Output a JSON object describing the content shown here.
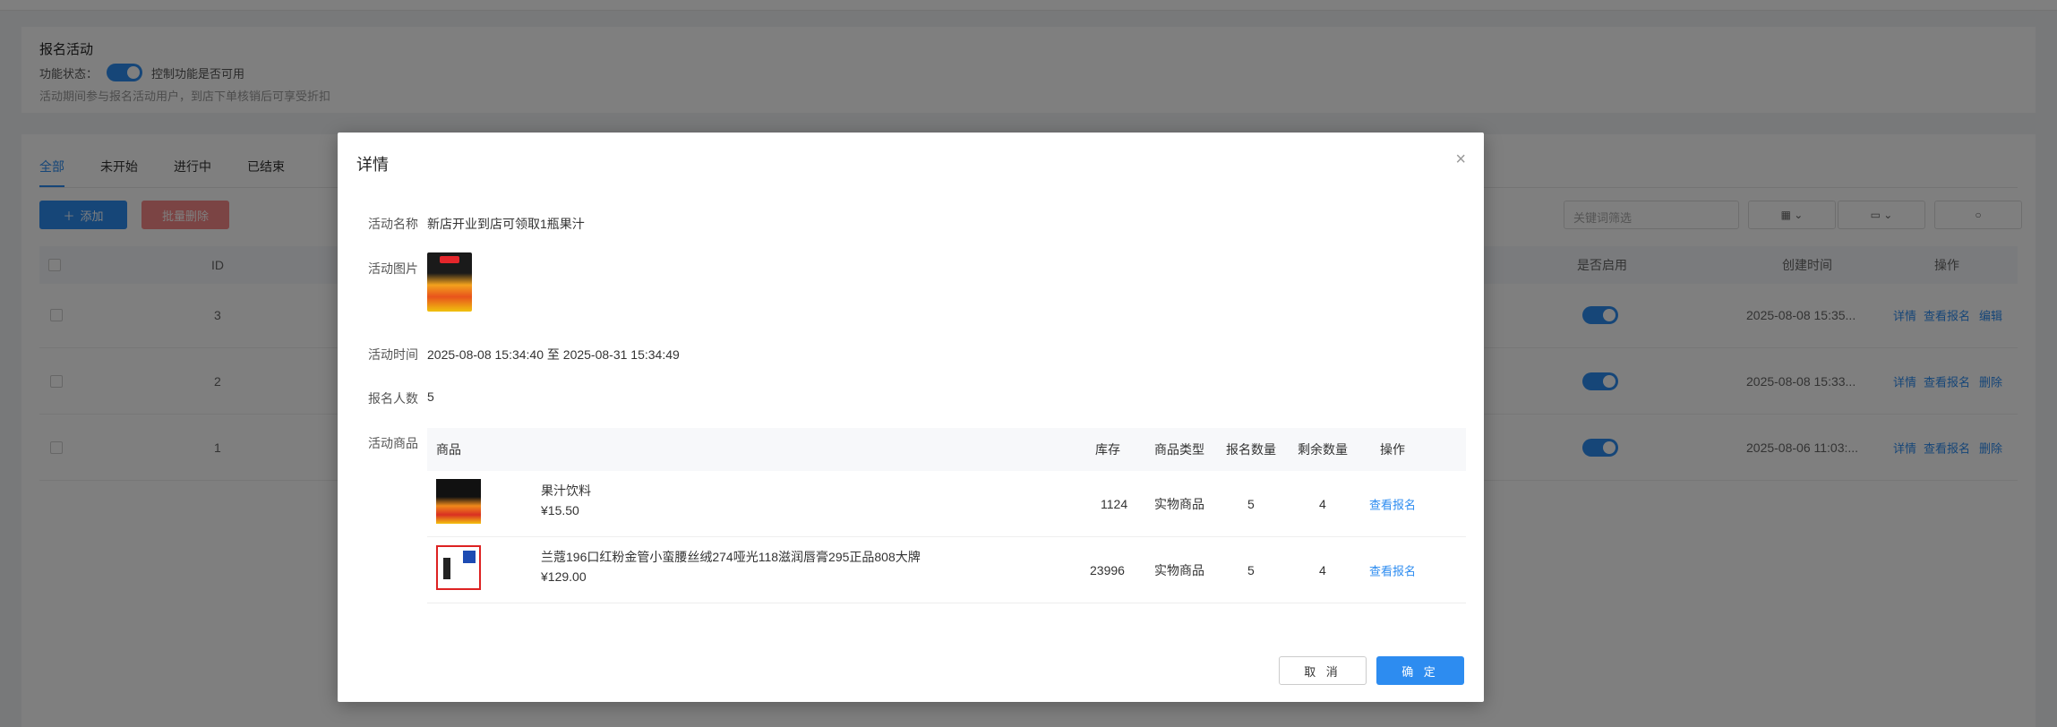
{
  "background": {
    "section_title": "报名活动",
    "status_label": "功能状态：",
    "status_desc": "控制功能是否可用",
    "hint": "活动期间参与报名活动用户，到店下单核销后可享受折扣",
    "tabs": [
      "全部",
      "未开始",
      "进行中",
      "已结束"
    ],
    "add_label": "添加",
    "batch_delete_label": "批量删除",
    "search_placeholder": "关键词筛选",
    "columns": {
      "id": "ID",
      "enabled": "是否启用",
      "created": "创建时间",
      "ops": "操作"
    },
    "rows": [
      {
        "id": "3",
        "created": "2025-08-08 15:35...",
        "op1": "详情",
        "op2": "查看报名",
        "op3": "编辑"
      },
      {
        "id": "2",
        "created": "2025-08-08 15:33...",
        "op1": "详情",
        "op2": "查看报名",
        "op3": "删除"
      },
      {
        "id": "1",
        "created": "2025-08-06 11:03:...",
        "op1": "详情",
        "op2": "查看报名",
        "op3": "删除"
      }
    ]
  },
  "modal": {
    "title": "详情",
    "name_label": "活动名称",
    "name_value": "新店开业到店可领取1瓶果汁",
    "image_label": "活动图片",
    "time_label": "活动时间",
    "time_value": "2025-08-08 15:34:40 至 2025-08-31 15:34:49",
    "count_label": "报名人数",
    "count_value": "5",
    "goods_label": "活动商品",
    "goods_columns": {
      "product": "商品",
      "stock": "库存",
      "type": "商品类型",
      "signup": "报名数量",
      "remaining": "剩余数量",
      "ops": "操作"
    },
    "goods": [
      {
        "name": "果汁饮料",
        "price": "¥15.50",
        "stock": "1124",
        "type": "实物商品",
        "signup": "5",
        "remaining": "4",
        "action": "查看报名"
      },
      {
        "name": "兰蔻196口红粉金管小蛮腰丝绒274哑光118滋润唇膏295正品808大牌",
        "price": "¥129.00",
        "stock": "23996",
        "type": "实物商品",
        "signup": "5",
        "remaining": "4",
        "action": "查看报名"
      }
    ],
    "cancel_label": "取 消",
    "ok_label": "确 定"
  }
}
